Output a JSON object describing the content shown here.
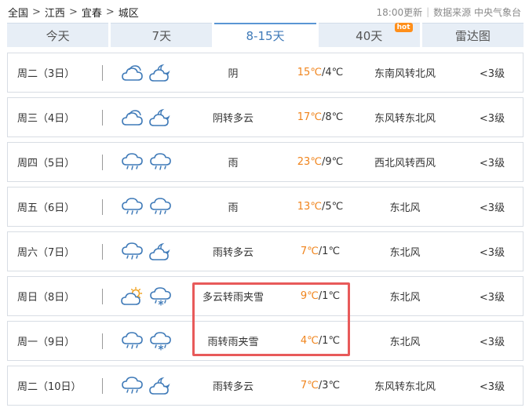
{
  "breadcrumb": [
    "全国",
    "江西",
    "宜春",
    "城区"
  ],
  "breadcrumb_sep": ">",
  "meta": {
    "update": "18:00更新",
    "separator": "|",
    "source": "数据来源 中央气象台"
  },
  "tabs": [
    {
      "label": "今天"
    },
    {
      "label": "7天"
    },
    {
      "label": "8-15天",
      "active": true
    },
    {
      "label": "40天",
      "badge": "hot"
    },
    {
      "label": "雷达图"
    }
  ],
  "colors": {
    "accent": "#3f7ab8",
    "high_temp": "#f0841c",
    "highlight_border": "#e85a5a",
    "hot_badge": "#ff8f1a"
  },
  "forecast": [
    {
      "date": "周二（3日）",
      "icons": [
        "overcast-icon",
        "night-cloudy-icon"
      ],
      "condition": "阴",
      "high": "15℃",
      "low": "/4℃",
      "wind": "东南风转北风",
      "level": "<3级"
    },
    {
      "date": "周三（4日）",
      "icons": [
        "overcast-icon",
        "night-cloudy-icon"
      ],
      "condition": "阴转多云",
      "high": "17℃",
      "low": "/8℃",
      "wind": "东风转东北风",
      "level": "<3级"
    },
    {
      "date": "周四（5日）",
      "icons": [
        "rain-icon",
        "rain-icon"
      ],
      "condition": "雨",
      "high": "23℃",
      "low": "/9℃",
      "wind": "西北风转西风",
      "level": "<3级"
    },
    {
      "date": "周五（6日）",
      "icons": [
        "rain-icon",
        "rain-icon"
      ],
      "condition": "雨",
      "high": "13℃",
      "low": "/5℃",
      "wind": "东北风",
      "level": "<3级"
    },
    {
      "date": "周六（7日）",
      "icons": [
        "rain-icon",
        "night-cloudy-icon"
      ],
      "condition": "雨转多云",
      "high": "7℃",
      "low": "/1℃",
      "wind": "东北风",
      "level": "<3级"
    },
    {
      "date": "周日（8日）",
      "icons": [
        "partly-cloudy-icon",
        "sleet-icon"
      ],
      "condition": "多云转雨夹雪",
      "high": "9℃",
      "low": "/1℃",
      "wind": "东北风",
      "level": "<3级"
    },
    {
      "date": "周一（9日）",
      "icons": [
        "rain-icon",
        "sleet-icon"
      ],
      "condition": "雨转雨夹雪",
      "high": "4℃",
      "low": "/1℃",
      "wind": "东北风",
      "level": "<3级"
    },
    {
      "date": "周二（10日）",
      "icons": [
        "rain-icon",
        "night-cloudy-icon"
      ],
      "condition": "雨转多云",
      "high": "7℃",
      "low": "/3℃",
      "wind": "东风转东北风",
      "level": "<3级"
    }
  ]
}
